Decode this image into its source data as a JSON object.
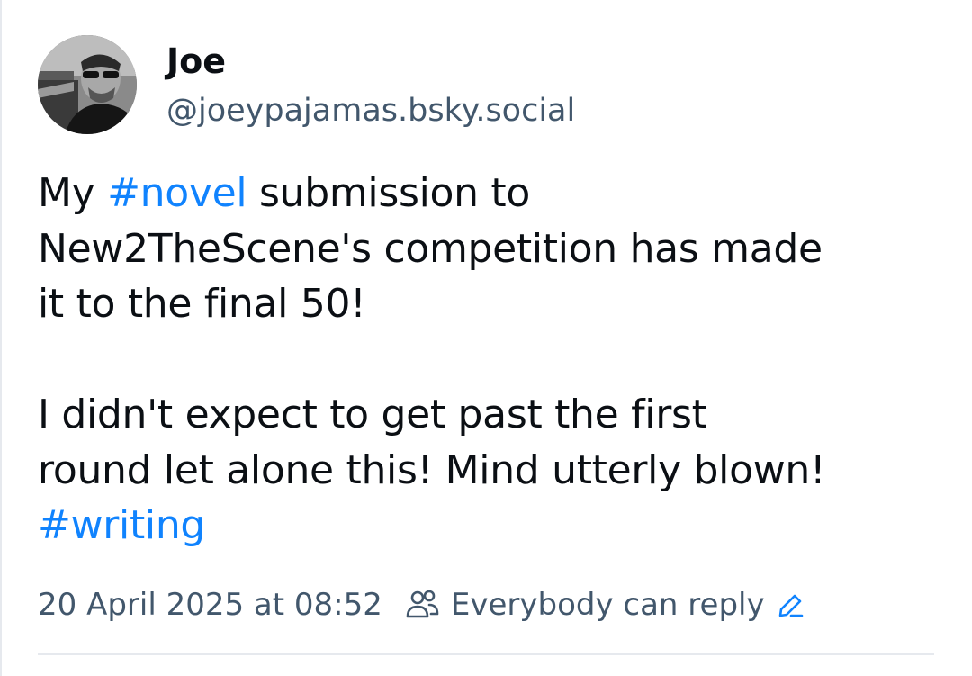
{
  "author": {
    "name": "Joe",
    "handle": "@joeypajamas.bsky.social"
  },
  "post": {
    "lines": [
      [
        {
          "text": "My ",
          "tag": false
        },
        {
          "text": "#novel",
          "tag": true
        },
        {
          "text": " submission to",
          "tag": false
        }
      ],
      [
        {
          "text": "New2TheScene's competition has made",
          "tag": false
        }
      ],
      [
        {
          "text": "it to the final 50!",
          "tag": false
        }
      ],
      [],
      [
        {
          "text": "I didn't expect to get past the first",
          "tag": false
        }
      ],
      [
        {
          "text": "round let alone this! Mind utterly blown!",
          "tag": false
        }
      ],
      [
        {
          "text": "#writing",
          "tag": true
        }
      ]
    ]
  },
  "meta": {
    "timestamp": "20 April 2025 at 08:52",
    "reply_setting": "Everybody can reply",
    "reply_icon": "people-icon",
    "edit_icon": "pencil-icon"
  },
  "colors": {
    "hashtag": "#1083fe",
    "secondary_text": "#42576c",
    "primary_text": "#0b0f14",
    "divider": "#e6e9ee"
  }
}
